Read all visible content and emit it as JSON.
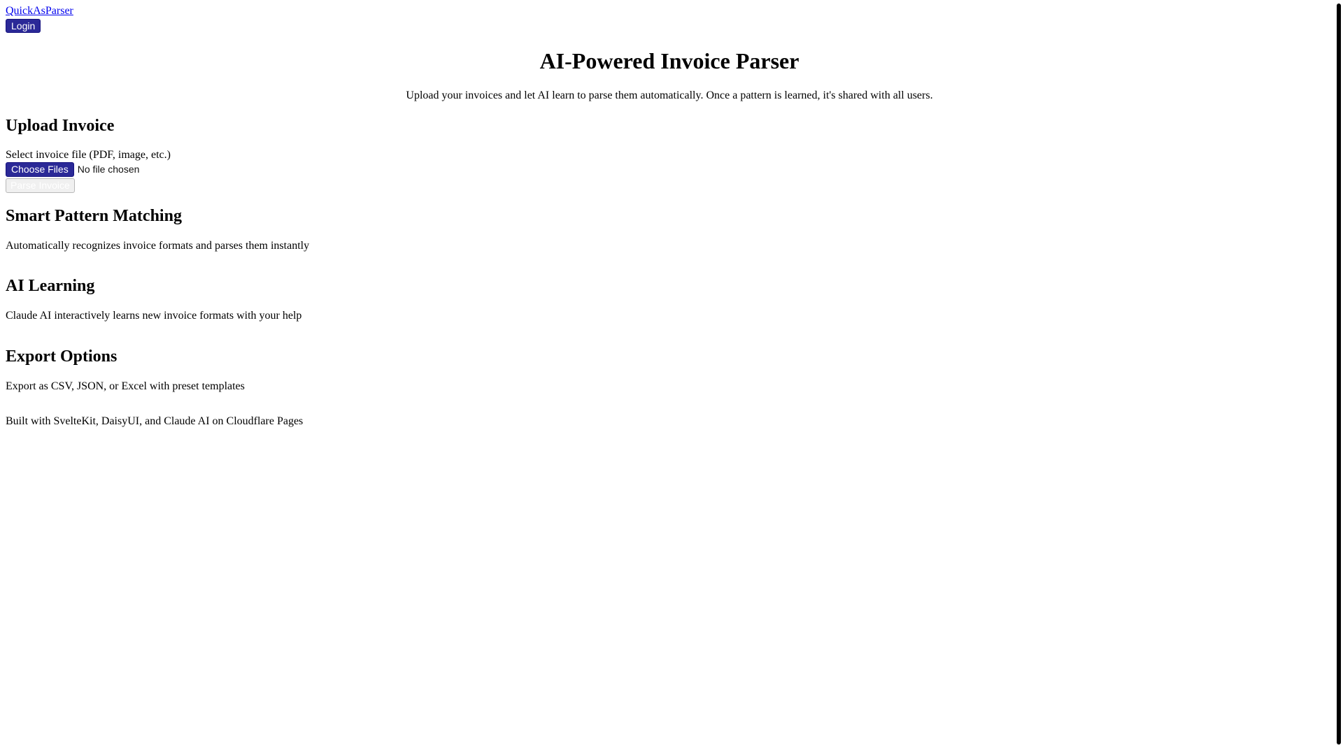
{
  "header": {
    "brand": "QuickAsParser",
    "login_label": "Login"
  },
  "hero": {
    "title": "AI-Powered Invoice Parser",
    "description": "Upload your invoices and let AI learn to parse them automatically. Once a pattern is learned, it's shared with all users."
  },
  "upload": {
    "heading": "Upload Invoice",
    "label": "Select invoice file (PDF, image, etc.)",
    "choose_files_label": "Choose Files",
    "file_status": "No file chosen",
    "parse_button_label": "Parse Invoice"
  },
  "features": {
    "smart_pattern": {
      "title": "Smart Pattern Matching",
      "description": "Automatically recognizes invoice formats and parses them instantly"
    },
    "ai_learning": {
      "title": "AI Learning",
      "description": "Claude AI interactively learns new invoice formats with your help"
    },
    "export_options": {
      "title": "Export Options",
      "description": "Export as CSV, JSON, or Excel with preset templates"
    }
  },
  "footer": {
    "text": "Built with SvelteKit, DaisyUI, and Claude AI on Cloudflare Pages"
  },
  "colors": {
    "primary_button": "#2b2997",
    "link": "#0000ee",
    "disabled_button": "#f0f0f0",
    "text": "#000000",
    "background": "#ffffff"
  }
}
